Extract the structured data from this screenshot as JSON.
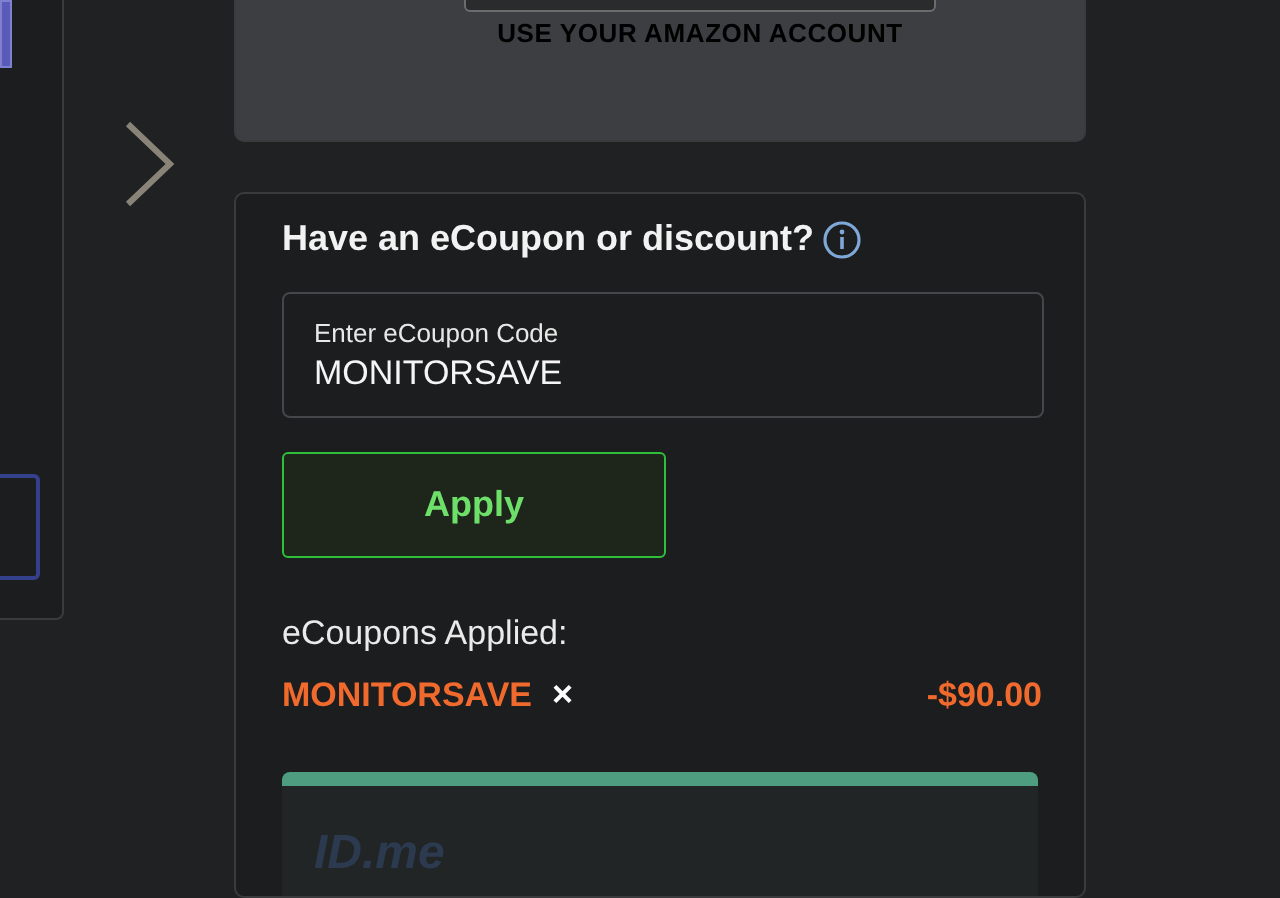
{
  "amazon_card": {
    "caption": "USE YOUR AMAZON ACCOUNT"
  },
  "coupon_card": {
    "title": "Have an eCoupon or discount?",
    "field": {
      "label": "Enter eCoupon Code",
      "value": "MONITORSAVE"
    },
    "apply_button": "Apply",
    "applied_label": "eCoupons Applied:",
    "applied": [
      {
        "code": "MONITORSAVE",
        "remove": "×",
        "amount": "-$90.00"
      }
    ]
  },
  "idme_card": {
    "logo": "ID.me"
  }
}
